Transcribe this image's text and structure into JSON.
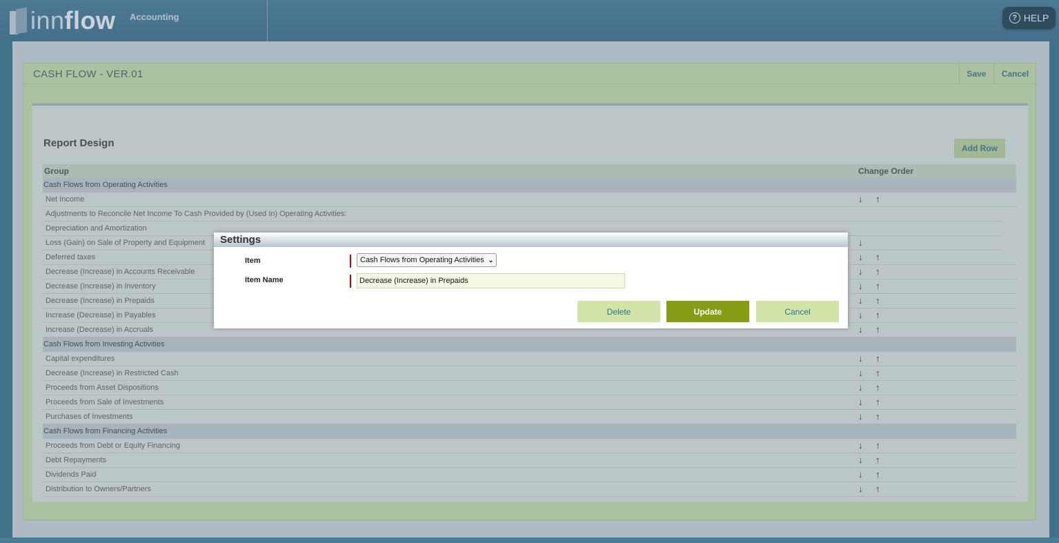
{
  "app": {
    "logo_light": "inn",
    "logo_bold": "flow",
    "module": "Accounting",
    "help_label": "HELP"
  },
  "report": {
    "title": "CASH FLOW - VER.01",
    "save_label": "Save",
    "cancel_label": "Cancel",
    "design_title": "Report Design",
    "add_row_label": "Add Row",
    "col_group": "Group",
    "col_change_order": "Change Order",
    "rows": [
      {
        "label": "Cash Flows from Operating Activities",
        "type": "group"
      },
      {
        "label": "Net Income",
        "down": true,
        "up": true
      },
      {
        "label": "Adjustments to Reconcile Net Income To Cash Provided by (Used In) Operating Activities:",
        "narrow": true
      },
      {
        "label": "Depreciation and Amortization",
        "narrow": true
      },
      {
        "label": "Loss (Gain) on Sale of Property and Equipment",
        "narrow": true,
        "down": true
      },
      {
        "label": "Deferred taxes",
        "down": true,
        "up": true
      },
      {
        "label": "Decrease (Increase) in Accounts Receivable",
        "down": true,
        "up": true
      },
      {
        "label": "Decrease (Increase) in Inventory",
        "down": true,
        "up": true
      },
      {
        "label": "Decrease (Increase) in Prepaids",
        "down": true,
        "up": true
      },
      {
        "label": "Increase (Decrease) in Payables",
        "down": true,
        "up": true
      },
      {
        "label": "Increase (Decrease) in Accruals",
        "down": true,
        "up": true
      },
      {
        "label": "Cash Flows from Investing Activities",
        "type": "group"
      },
      {
        "label": "Capital expenditures",
        "down": true,
        "up": true
      },
      {
        "label": "Decrease (Increase) in Restricted Cash",
        "down": true,
        "up": true
      },
      {
        "label": "Proceeds from Asset Dispositions",
        "down": true,
        "up": true
      },
      {
        "label": "Proceeds from Sale of Investments",
        "down": true,
        "up": true
      },
      {
        "label": "Purchases of Investments",
        "down": true,
        "up": true
      },
      {
        "label": "Cash Flows from Financing Activities",
        "type": "group"
      },
      {
        "label": "Proceeds from Debt or Equity Financing",
        "down": true,
        "up": true
      },
      {
        "label": "Debt Repayments",
        "down": true,
        "up": true
      },
      {
        "label": "Dividends Paid",
        "down": true,
        "up": true
      },
      {
        "label": "Distribution to Owners/Partners",
        "down": true,
        "up": true
      }
    ]
  },
  "dialog": {
    "title": "Settings",
    "item_label": "Item",
    "item_value": "Cash Flows from Operating Activities",
    "item_name_label": "Item Name",
    "item_name_value": "Decrease (Increase) in Prepaids",
    "delete_label": "Delete",
    "update_label": "Update",
    "cancel_label": "Cancel"
  },
  "icons": {
    "down_arrow": "↓",
    "up_arrow": "↑",
    "help": "?"
  }
}
